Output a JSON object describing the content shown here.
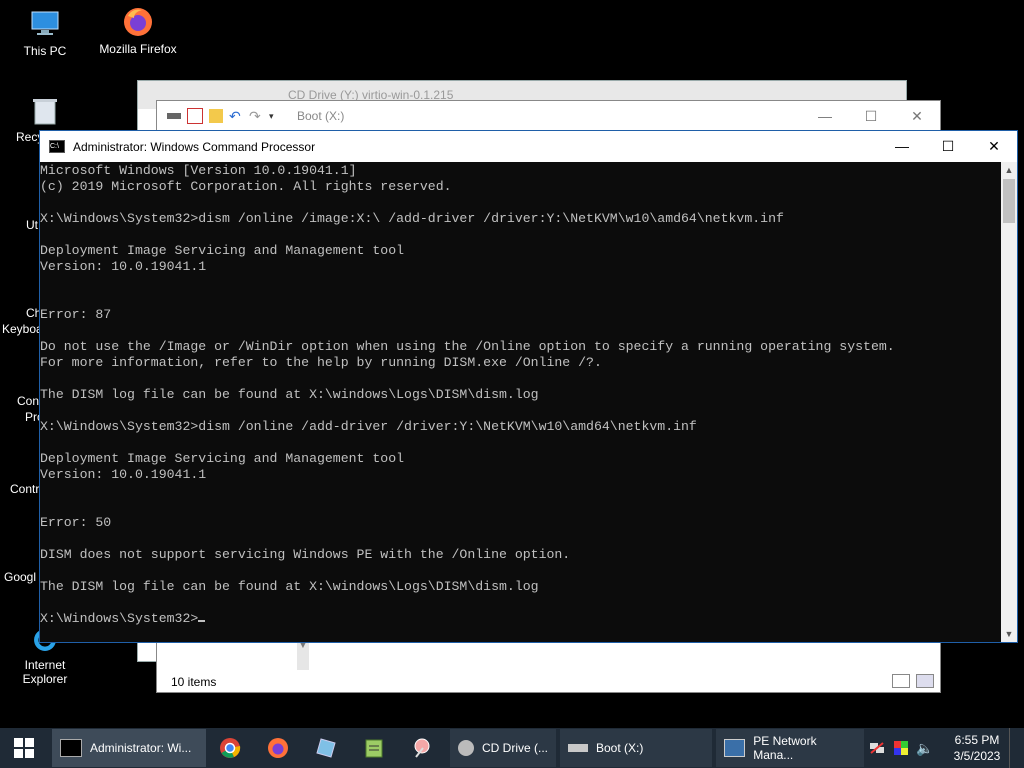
{
  "desktop": {
    "icons": [
      {
        "label": "This PC"
      },
      {
        "label": "Mozilla Firefox"
      },
      {
        "label": "Internet Explorer"
      }
    ],
    "partial_labels": [
      "Recy",
      "Ut",
      "Ch",
      "Keyboa",
      "Con",
      "Pro",
      "Contr",
      "Googl"
    ]
  },
  "cd_window": {
    "title": "CD Drive (Y:) virtio-win-0.1.215"
  },
  "boot_window": {
    "title": "Boot (X:)",
    "status": "10 items"
  },
  "cmd_window": {
    "title": "Administrator: Windows Command Processor",
    "lines": [
      "Microsoft Windows [Version 10.0.19041.1]",
      "(c) 2019 Microsoft Corporation. All rights reserved.",
      "",
      "X:\\Windows\\System32>dism /online /image:X:\\ /add-driver /driver:Y:\\NetKVM\\w10\\amd64\\netkvm.inf",
      "",
      "Deployment Image Servicing and Management tool",
      "Version: 10.0.19041.1",
      "",
      "",
      "Error: 87",
      "",
      "Do not use the /Image or /WinDir option when using the /Online option to specify a running operating system.",
      "For more information, refer to the help by running DISM.exe /Online /?.",
      "",
      "The DISM log file can be found at X:\\windows\\Logs\\DISM\\dism.log",
      "",
      "X:\\Windows\\System32>dism /online /add-driver /driver:Y:\\NetKVM\\w10\\amd64\\netkvm.inf",
      "",
      "Deployment Image Servicing and Management tool",
      "Version: 10.0.19041.1",
      "",
      "",
      "Error: 50",
      "",
      "DISM does not support servicing Windows PE with the /Online option.",
      "",
      "The DISM log file can be found at X:\\windows\\Logs\\DISM\\dism.log",
      "",
      "X:\\Windows\\System32>"
    ]
  },
  "taskbar": {
    "tasks": [
      {
        "label": "Administrator: Wi...",
        "active": true
      },
      {
        "label": "CD Drive (...",
        "active": false
      },
      {
        "label": "Boot (X:)",
        "active": false
      },
      {
        "label": "PE Network Mana...",
        "active": false
      }
    ],
    "clock_time": "6:55 PM",
    "clock_date": "3/5/2023"
  },
  "colors": {
    "console_bg": "#0c0c0c",
    "console_text": "#c0c0c0",
    "taskbar_bg": "#1f2a36",
    "accent": "#0078d7"
  }
}
